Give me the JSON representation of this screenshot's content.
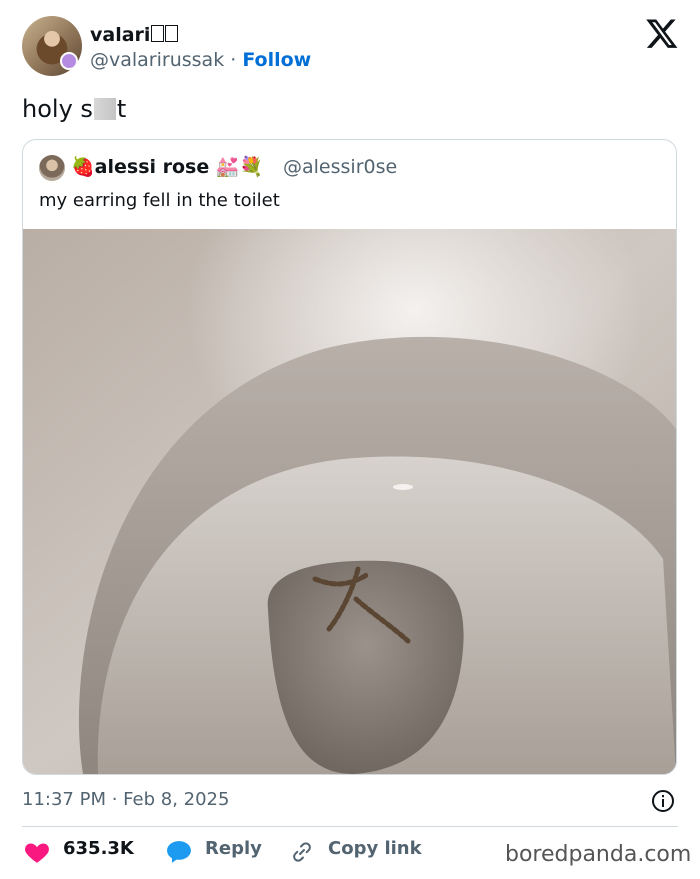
{
  "author": {
    "display_name": "valari",
    "handle": "@valarirussak",
    "separator": "·",
    "follow_label": "Follow"
  },
  "tweet": {
    "text_before": "holy s",
    "text_after": "t"
  },
  "quoted_tweet": {
    "display_name": "alessi rose",
    "name_prefix_emoji": "🍓",
    "name_suffix_emoji": "💒💐",
    "handle": "@alessir0se",
    "text": "my earring fell in the toilet"
  },
  "footer": {
    "timestamp": "11:37 PM · Feb 8, 2025",
    "likes_count": "635.3K",
    "reply_label": "Reply",
    "copy_link_label": "Copy link"
  },
  "watermark": "boredpanda.com",
  "colors": {
    "link_blue": "#006fd6",
    "like_red": "#f91880",
    "reply_blue": "#1d9bf0",
    "secondary_text": "#536471"
  }
}
